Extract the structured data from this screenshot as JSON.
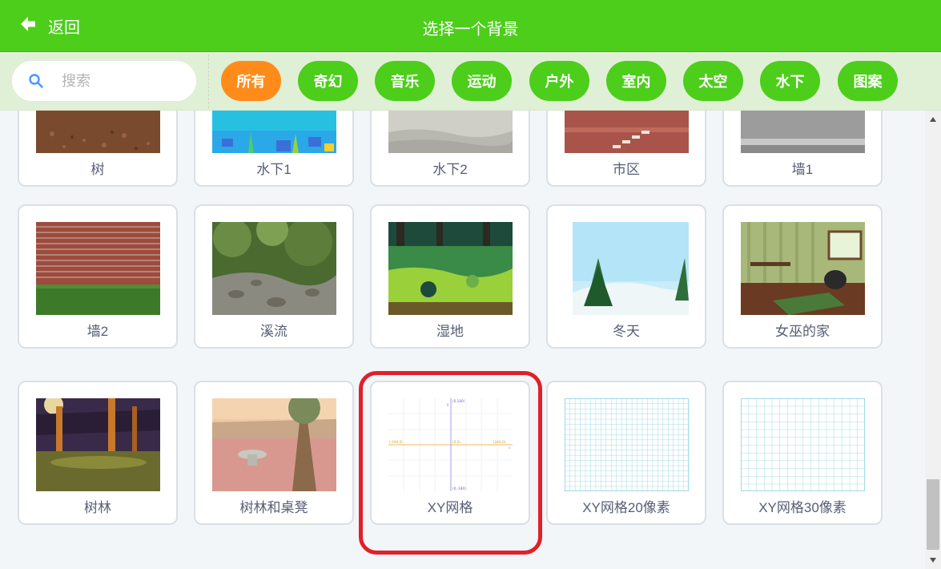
{
  "header": {
    "back_label": "返回",
    "title": "选择一个背景",
    "background_color": "#4cce1a"
  },
  "search": {
    "placeholder": "搜索",
    "icon": "search-icon"
  },
  "categories": {
    "items": [
      "所有",
      "奇幻",
      "音乐",
      "运动",
      "户外",
      "室内",
      "太空",
      "水下",
      "图案"
    ],
    "selected": "所有",
    "selected_color": "#ff8c1a",
    "pill_color": "#4cce1a"
  },
  "backdrops": [
    {
      "name": "树"
    },
    {
      "name": "水下1"
    },
    {
      "name": "水下2"
    },
    {
      "name": "市区"
    },
    {
      "name": "墙1"
    },
    {
      "name": "墙2"
    },
    {
      "name": "溪流"
    },
    {
      "name": "湿地"
    },
    {
      "name": "冬天"
    },
    {
      "name": "女巫的家"
    },
    {
      "name": "树林"
    },
    {
      "name": "树林和桌凳"
    },
    {
      "name": "XY网格"
    },
    {
      "name": "XY网格20像素"
    },
    {
      "name": "XY网格30像素"
    }
  ],
  "highlighted_backdrop": "XY网格",
  "highlight_color": "#e0202a",
  "xy_grid_labels": {
    "top": "(0,180)",
    "bottom": "(0,-180)",
    "left": "(-240,0)",
    "right": "(240,0)",
    "center": "(0,0)",
    "x_axis": "x",
    "y_axis": "y"
  }
}
